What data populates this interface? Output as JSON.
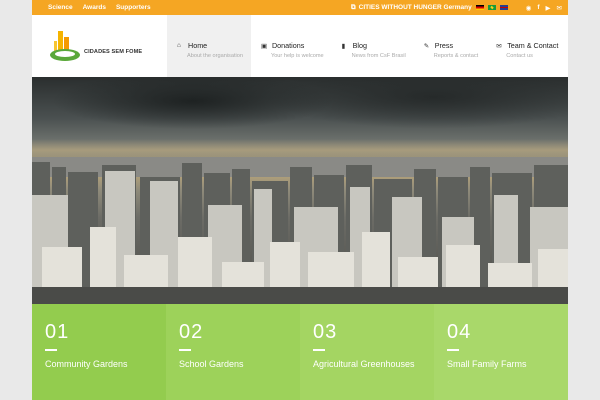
{
  "topbar": {
    "links": [
      "Science",
      "Awards",
      "Supporters"
    ],
    "cwh_label": "CITIES WITHOUT HUNGER Germany",
    "social_icons": [
      "rss-icon",
      "facebook-icon",
      "youtube-icon",
      "mail-icon"
    ]
  },
  "logo": {
    "text": "CIDADES SEM FOME"
  },
  "nav": [
    {
      "title": "Home",
      "sub": "About the organisation",
      "icon": "home-icon",
      "glyph": "⌂",
      "active": true
    },
    {
      "title": "Donations",
      "sub": "Your help is welcome",
      "icon": "money-icon",
      "glyph": "▣",
      "active": false
    },
    {
      "title": "Blog",
      "sub": "News from CsF Brasil",
      "icon": "bookmark-icon",
      "glyph": "▮",
      "active": false
    },
    {
      "title": "Press",
      "sub": "Reports & contact",
      "icon": "pencil-icon",
      "glyph": "✎",
      "active": false
    },
    {
      "title": "Team & Contact",
      "sub": "Contact us",
      "icon": "envelope-icon",
      "glyph": "✉",
      "active": false
    }
  ],
  "tiles": [
    {
      "num": "01",
      "label": "Community Gardens"
    },
    {
      "num": "02",
      "label": "School Gardens"
    },
    {
      "num": "03",
      "label": "Agricultural Greenhouses"
    },
    {
      "num": "04",
      "label": "Small Family Farms"
    }
  ],
  "colors": {
    "accent": "#f5a623",
    "green": "#9dd25a"
  }
}
